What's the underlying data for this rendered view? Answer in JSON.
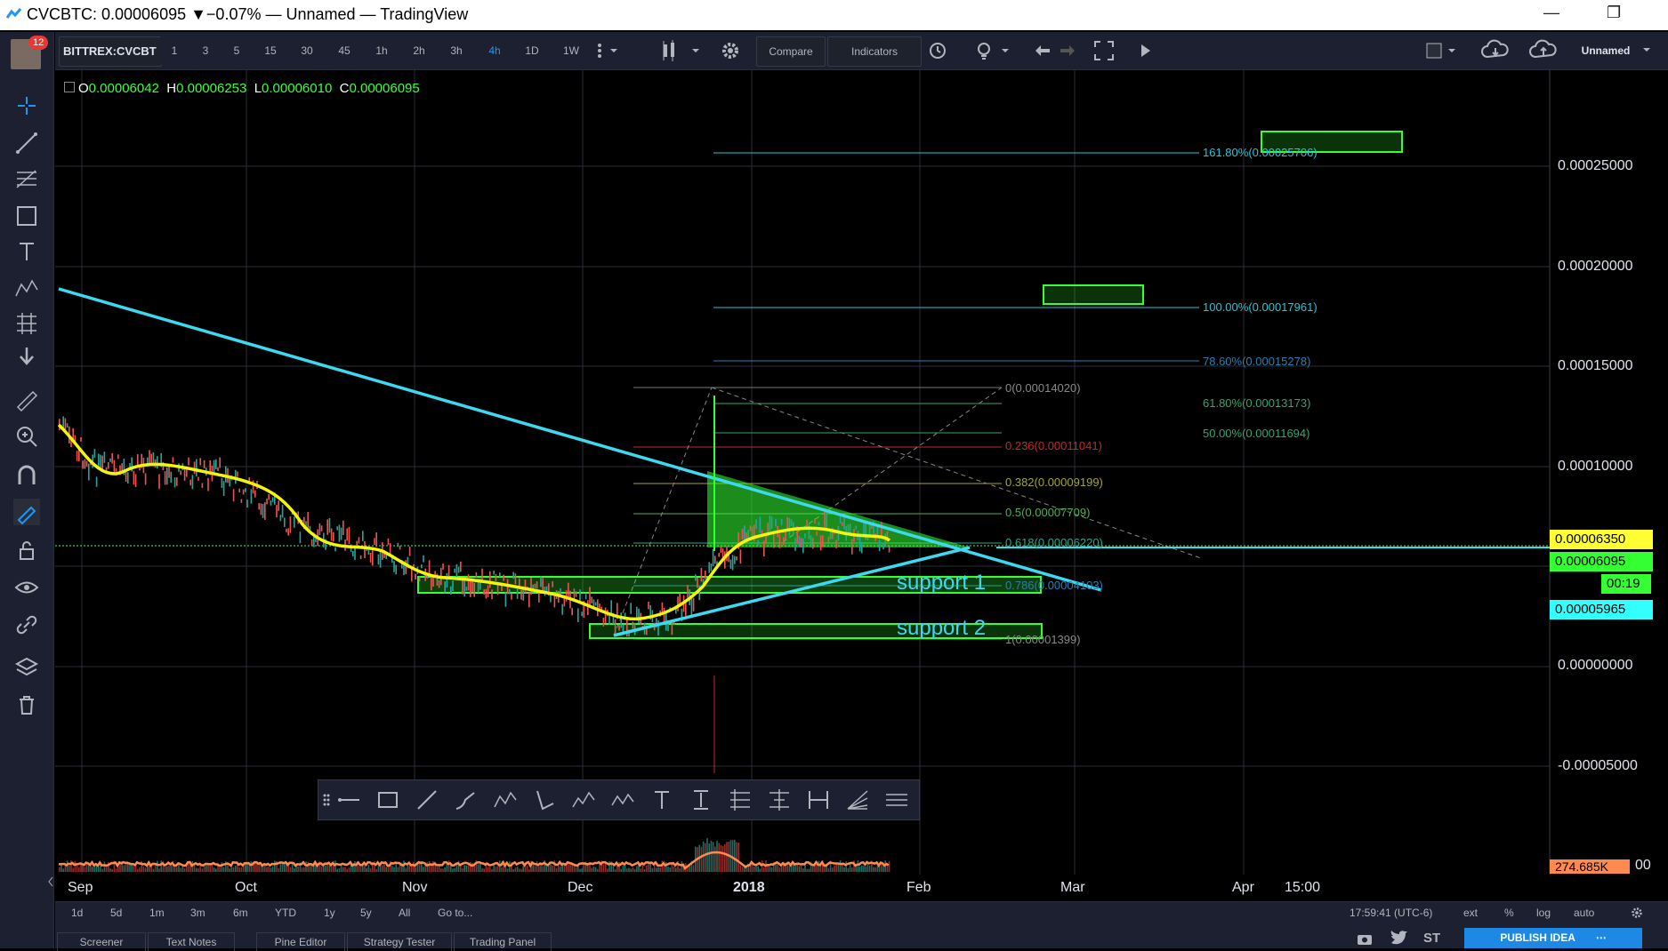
{
  "window": {
    "title": "CVCBTC: 0.00006095 ▼−0.07% — Unnamed — TradingView",
    "minimize": "—",
    "restore": "❐"
  },
  "user": {
    "notifications": "12"
  },
  "toolbar": {
    "symbol": "BITTREX:CVCBT",
    "intervals": [
      "1",
      "3",
      "5",
      "15",
      "30",
      "45",
      "1h",
      "2h",
      "3h",
      "4h",
      "1D",
      "1W"
    ],
    "active_interval": "4h",
    "compare": "Compare",
    "indicators": "Indicators",
    "layout_name": "Unnamed"
  },
  "ohlc": {
    "o_label": "O",
    "o": "0.00006042",
    "h_label": "H",
    "h": "0.00006253",
    "l_label": "L",
    "l": "0.00006010",
    "c_label": "C",
    "c": "0.00006095"
  },
  "price_axis": [
    "0.00025000",
    "0.00020000",
    "0.00015000",
    "0.00010000",
    "0.00000000",
    "-0.00005000"
  ],
  "price_axis_extra": "00",
  "price_labels": {
    "line": "0.00006350",
    "last": "0.00006095",
    "countdown": "00:19",
    "ma": "0.00005965",
    "volume": "274.685K"
  },
  "time_axis": [
    "Sep",
    "Oct",
    "Nov",
    "Dec",
    "2018",
    "Feb",
    "Mar",
    "Apr",
    "15:00"
  ],
  "fib_extension": [
    "161.80%(0.00025706)",
    "100.00%(0.00017961)",
    "78.60%(0.00015278)",
    "61.80%(0.00013173)",
    "50.00%(0.00011694)"
  ],
  "fib_retracement": [
    "0(0.00014020)",
    "0.236(0.00011041)",
    "0.382(0.00009199)",
    "0.5(0.00007709)",
    "0.618(0.00006220)",
    "0.786(0.00004103)",
    "1(0.00001399)"
  ],
  "annotations": {
    "support1": "support  1",
    "support2": "support  2"
  },
  "bottom": {
    "ranges": [
      "1d",
      "5d",
      "1m",
      "3m",
      "6m",
      "YTD",
      "1y",
      "5y",
      "All"
    ],
    "goto": "Go to...",
    "clock": "17:59:41 (UTC-6)",
    "ext": "ext",
    "percent": "%",
    "log": "log",
    "auto": "auto"
  },
  "panels": [
    "Screener",
    "Text Notes",
    "Pine Editor",
    "Strategy Tester",
    "Trading Panel"
  ],
  "publish": "PUBLISH IDEA",
  "colors": {
    "background": "#000000",
    "toolbar": "#1c2030",
    "trendline": "#3dd9f0",
    "ma": "#f5f50a",
    "zone": "#33ff33",
    "accent": "#2196f3"
  }
}
